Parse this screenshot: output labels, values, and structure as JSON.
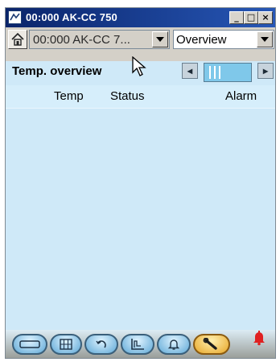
{
  "window": {
    "title": "00:000 AK-CC 750"
  },
  "window_controls": {
    "minimize": "_",
    "maximize": "□",
    "close": "×"
  },
  "toolbar": {
    "device_selector": {
      "value": "00:000 AK-CC 7..."
    },
    "view_selector": {
      "value": "Overview"
    }
  },
  "section": {
    "title": "Temp. overview"
  },
  "zoom": {
    "minus": "◂",
    "plus": "▸"
  },
  "table": {
    "columns": [
      "Temp",
      "Status",
      "Alarm"
    ],
    "rows": []
  },
  "bottom_nav": {
    "items": [
      {
        "icon": "display-icon"
      },
      {
        "icon": "grid-icon"
      },
      {
        "icon": "undo-icon"
      },
      {
        "icon": "graph-icon"
      },
      {
        "icon": "bell-icon"
      },
      {
        "icon": "wrench-icon",
        "active": true
      }
    ],
    "alarm_indicator": {
      "icon": "alarm-bell-icon",
      "color": "#e02020"
    }
  },
  "colors": {
    "title_bar": "#0a246a",
    "panel": "#cfe9f8",
    "accent": "#7fc8ea"
  }
}
